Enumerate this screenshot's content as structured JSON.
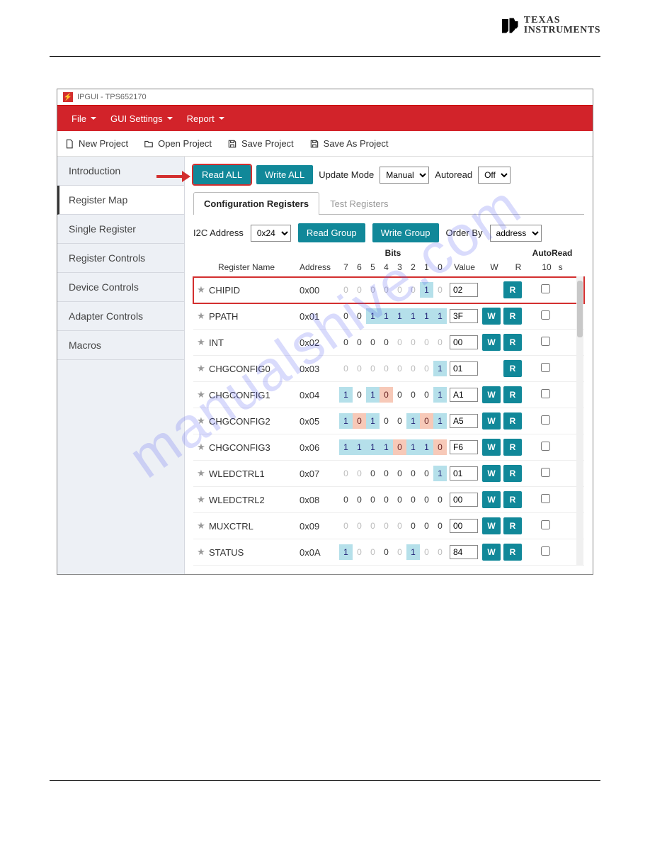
{
  "brand": {
    "line1": "TEXAS",
    "line2": "INSTRUMENTS"
  },
  "window": {
    "title": "IPGUI - TPS652170"
  },
  "menu": {
    "file": "File",
    "gui_settings": "GUI Settings",
    "report": "Report"
  },
  "toolbar": {
    "new": "New Project",
    "open": "Open Project",
    "save": "Save Project",
    "save_as": "Save As Project"
  },
  "sidebar": {
    "items": [
      "Introduction",
      "Register Map",
      "Single Register",
      "Register Controls",
      "Device Controls",
      "Adapter Controls",
      "Macros"
    ],
    "active_index": 1
  },
  "actions": {
    "read_all": "Read ALL",
    "write_all": "Write ALL",
    "update_mode_label": "Update Mode",
    "update_mode_value": "Manual",
    "autoread_label": "Autoread",
    "autoread_value": "Off"
  },
  "tabs": {
    "config": "Configuration Registers",
    "test": "Test Registers"
  },
  "group": {
    "i2c_label": "I2C Address",
    "i2c_value": "0x24",
    "read_group": "Read Group",
    "write_group": "Write Group",
    "order_by_label": "Order By",
    "order_by_value": "address"
  },
  "table": {
    "bits_header": "Bits",
    "autoread_header": "AutoRead",
    "cols": {
      "name": "Register Name",
      "addr": "Address",
      "value": "Value",
      "w": "W",
      "r": "R",
      "a10": "10",
      "as": "s"
    },
    "bit_labels": [
      "7",
      "6",
      "5",
      "4",
      "3",
      "2",
      "1",
      "0"
    ],
    "rows": [
      {
        "name": "CHIPID",
        "addr": "0x00",
        "bits": [
          "0d",
          "0d",
          "0d",
          "0d",
          "0d",
          "0d",
          "1",
          "0d"
        ],
        "value": "02",
        "w": false,
        "r": true,
        "hl": true
      },
      {
        "name": "PPATH",
        "addr": "0x01",
        "bits": [
          "0",
          "0",
          "1",
          "1",
          "1",
          "1",
          "1",
          "1"
        ],
        "value": "3F",
        "w": true,
        "r": true,
        "hl": false
      },
      {
        "name": "INT",
        "addr": "0x02",
        "bits": [
          "0",
          "0",
          "0",
          "0",
          "0d",
          "0d",
          "0d",
          "0d"
        ],
        "value": "00",
        "w": true,
        "r": true,
        "hl": false
      },
      {
        "name": "CHGCONFIG0",
        "addr": "0x03",
        "bits": [
          "0d",
          "0d",
          "0d",
          "0d",
          "0d",
          "0d",
          "0d",
          "1"
        ],
        "value": "01",
        "w": false,
        "r": true,
        "hl": false
      },
      {
        "name": "CHGCONFIG1",
        "addr": "0x04",
        "bits": [
          "1",
          "0",
          "1",
          "0r",
          "0",
          "0",
          "0",
          "1"
        ],
        "value": "A1",
        "w": true,
        "r": true,
        "hl": false
      },
      {
        "name": "CHGCONFIG2",
        "addr": "0x05",
        "bits": [
          "1",
          "0r",
          "1",
          "0",
          "0",
          "1",
          "0r",
          "1"
        ],
        "value": "A5",
        "w": true,
        "r": true,
        "hl": false
      },
      {
        "name": "CHGCONFIG3",
        "addr": "0x06",
        "bits": [
          "1",
          "1",
          "1",
          "1",
          "0r",
          "1",
          "1",
          "0r"
        ],
        "value": "F6",
        "w": true,
        "r": true,
        "hl": false
      },
      {
        "name": "WLEDCTRL1",
        "addr": "0x07",
        "bits": [
          "0d",
          "0d",
          "0",
          "0",
          "0",
          "0",
          "0",
          "1"
        ],
        "value": "01",
        "w": true,
        "r": true,
        "hl": false
      },
      {
        "name": "WLEDCTRL2",
        "addr": "0x08",
        "bits": [
          "0",
          "0",
          "0",
          "0",
          "0",
          "0",
          "0",
          "0"
        ],
        "value": "00",
        "w": true,
        "r": true,
        "hl": false
      },
      {
        "name": "MUXCTRL",
        "addr": "0x09",
        "bits": [
          "0d",
          "0d",
          "0d",
          "0d",
          "0d",
          "0",
          "0",
          "0"
        ],
        "value": "00",
        "w": true,
        "r": true,
        "hl": false
      },
      {
        "name": "STATUS",
        "addr": "0x0A",
        "bits": [
          "1",
          "0d",
          "0d",
          "0",
          "0d",
          "1",
          "0d",
          "0d"
        ],
        "value": "84",
        "w": true,
        "r": true,
        "hl": false
      }
    ]
  },
  "watermark": "manualshive.com"
}
